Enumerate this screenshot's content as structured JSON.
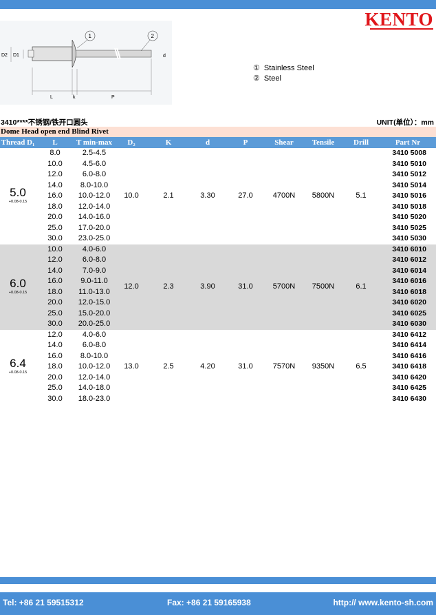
{
  "brand": "KENTO",
  "legend": [
    {
      "mark": "①",
      "label": "Stainless Steel"
    },
    {
      "mark": "②",
      "label": "Steel"
    }
  ],
  "drawing_labels": {
    "d2": "D2",
    "d1": "D1",
    "c1": "1",
    "c2": "2",
    "d": "d",
    "l": "L",
    "k": "k",
    "p": "P"
  },
  "subtitle": "3410****不锈钢/铁开口圆头",
  "unit": "UNIT(单位）：mm",
  "title": "Dome Head open end Blind Rivet",
  "headers": {
    "thread": "Thread D₁",
    "l": "L",
    "t": "T min-max",
    "d2": "D₂",
    "k": "K",
    "d": "d",
    "p": "P",
    "shear": "Shear",
    "tensile": "Tensile",
    "drill": "Drill",
    "part": "Part Nr"
  },
  "groups": [
    {
      "thread": "5.0",
      "tolerance": "+0.08-0.15",
      "d2": "10.0",
      "k": "2.1",
      "d": "3.30",
      "p": "27.0",
      "shear": "4700N",
      "tensile": "5800N",
      "drill": "5.1",
      "rows": [
        {
          "l": "8.0",
          "t": "2.5-4.5",
          "part": "3410 5008"
        },
        {
          "l": "10.0",
          "t": "4.5-6.0",
          "part": "3410 5010"
        },
        {
          "l": "12.0",
          "t": "6.0-8.0",
          "part": "3410 5012"
        },
        {
          "l": "14.0",
          "t": "8.0-10.0",
          "part": "3410 5014"
        },
        {
          "l": "16.0",
          "t": "10.0-12.0",
          "part": "3410 5016"
        },
        {
          "l": "18.0",
          "t": "12.0-14.0",
          "part": "3410 5018"
        },
        {
          "l": "20.0",
          "t": "14.0-16.0",
          "part": "3410 5020"
        },
        {
          "l": "25.0",
          "t": "17.0-20.0",
          "part": "3410 5025"
        },
        {
          "l": "30.0",
          "t": "23.0-25.0",
          "part": "3410 5030"
        }
      ]
    },
    {
      "thread": "6.0",
      "tolerance": "+0.08-0.15",
      "d2": "12.0",
      "k": "2.3",
      "d": "3.90",
      "p": "31.0",
      "shear": "5700N",
      "tensile": "7500N",
      "drill": "6.1",
      "rows": [
        {
          "l": "10.0",
          "t": "4.0-6.0",
          "part": "3410 6010"
        },
        {
          "l": "12.0",
          "t": "6.0-8.0",
          "part": "3410 6012"
        },
        {
          "l": "14.0",
          "t": "7.0-9.0",
          "part": "3410 6014"
        },
        {
          "l": "16.0",
          "t": "9.0-11.0",
          "part": "3410 6016"
        },
        {
          "l": "18.0",
          "t": "11.0-13.0",
          "part": "3410 6018"
        },
        {
          "l": "20.0",
          "t": "12.0-15.0",
          "part": "3410 6020"
        },
        {
          "l": "25.0",
          "t": "15.0-20.0",
          "part": "3410 6025"
        },
        {
          "l": "30.0",
          "t": "20.0-25.0",
          "part": "3410 6030"
        }
      ]
    },
    {
      "thread": "6.4",
      "tolerance": "+0.08-0.15",
      "d2": "13.0",
      "k": "2.5",
      "d": "4.20",
      "p": "31.0",
      "shear": "7570N",
      "tensile": "9350N",
      "drill": "6.5",
      "rows": [
        {
          "l": "12.0",
          "t": "4.0-6.0",
          "part": "3410 6412"
        },
        {
          "l": "14.0",
          "t": "6.0-8.0",
          "part": "3410 6414"
        },
        {
          "l": "16.0",
          "t": "8.0-10.0",
          "part": "3410 6416"
        },
        {
          "l": "18.0",
          "t": "10.0-12.0",
          "part": "3410 6418"
        },
        {
          "l": "20.0",
          "t": "12.0-14.0",
          "part": "3410 6420"
        },
        {
          "l": "25.0",
          "t": "14.0-18.0",
          "part": "3410 6425"
        },
        {
          "l": "30.0",
          "t": "18.0-23.0",
          "part": "3410 6430"
        }
      ]
    }
  ],
  "footer": {
    "tel": "Tel: +86 21 59515312",
    "fax": "Fax: +86 21 59165938",
    "web": "http:// www.kento-sh.com"
  }
}
